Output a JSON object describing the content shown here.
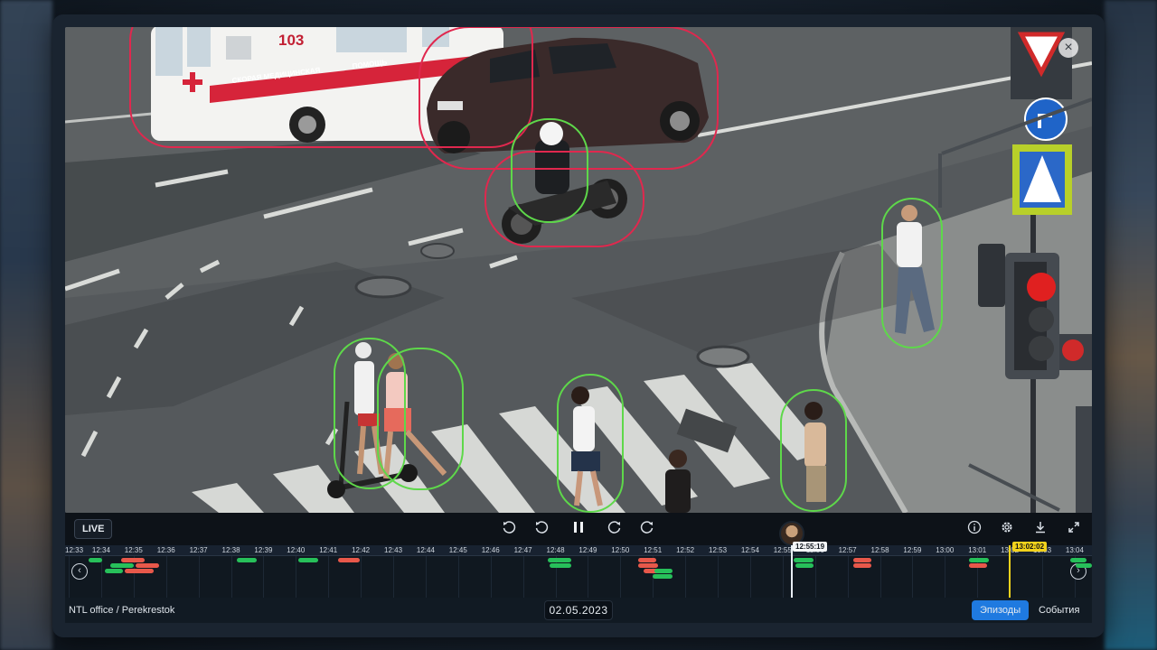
{
  "camera": {
    "name": "NTL office / Perekrestok"
  },
  "video": {
    "ambulance_number": "103",
    "ambulance_text_1": "СКОРАЯ МЕДИЦИНСКАЯ",
    "ambulance_text_2": "ПОМОЩЬ"
  },
  "controls": {
    "live_label": "LIVE",
    "rewind_long_icon": "rewind-30-icon",
    "rewind_short_icon": "rewind-10-icon",
    "pause_icon": "pause-icon",
    "forward_short_icon": "forward-10-icon",
    "forward_long_icon": "forward-30-icon",
    "info_icon": "info-icon",
    "settings_icon": "gear-icon",
    "download_icon": "download-icon",
    "fullscreen_icon": "fullscreen-icon"
  },
  "timeline": {
    "ticks": [
      "12:33",
      "12:34",
      "12:35",
      "12:36",
      "12:37",
      "12:38",
      "12:39",
      "12:40",
      "12:41",
      "12:42",
      "12:43",
      "12:44",
      "12:45",
      "12:46",
      "12:47",
      "12:48",
      "12:49",
      "12:50",
      "12:51",
      "12:52",
      "12:53",
      "12:54",
      "12:55",
      "12:56",
      "12:57",
      "12:58",
      "12:59",
      "13:00",
      "13:01",
      "13:02",
      "13:03",
      "13:04"
    ],
    "current_time": "12:55:19",
    "selected_time": "13:02:02",
    "colors": {
      "person": "#27c05a",
      "vehicle": "#e8584a",
      "cursor": "#e8eef4",
      "selection": "#f2d21c"
    }
  },
  "footer": {
    "date": "02.05.2023",
    "tab_episodes": "Эпизоды",
    "tab_events": "События"
  },
  "colors": {
    "accent": "#1f7ae0",
    "box_person": "#5ed84a",
    "box_vehicle": "#e0284e"
  }
}
